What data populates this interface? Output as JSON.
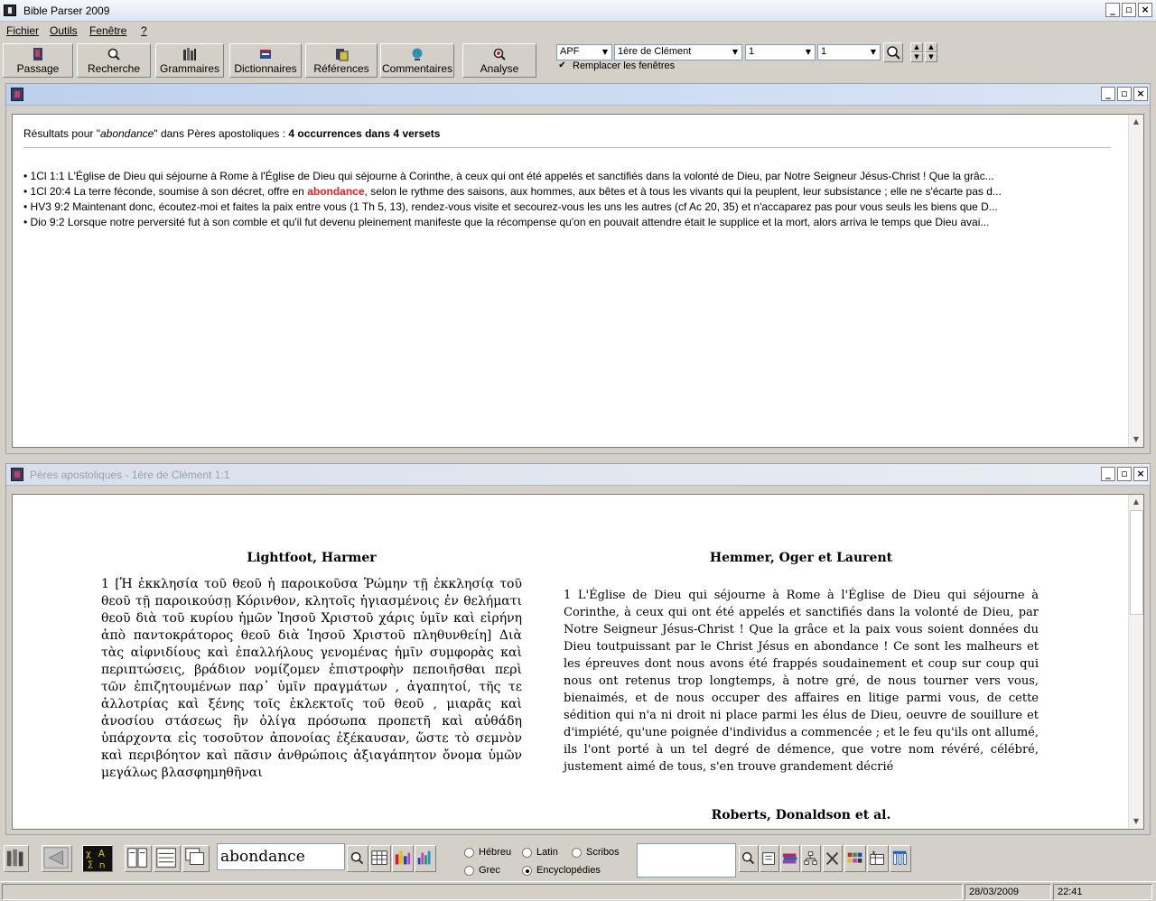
{
  "app": {
    "title": "Bible Parser 2009"
  },
  "window_buttons": {
    "minimize": "_",
    "restore": "▫",
    "close": "×"
  },
  "menu": [
    "Fichier",
    "Outils",
    "Fenêtre",
    "?"
  ],
  "toolbar": {
    "buttons": [
      "Passage",
      "Recherche",
      "Grammaires",
      "Dictionnaires",
      "Références",
      "Commentaires",
      "Analyse"
    ],
    "combo_version": "APF",
    "combo_book": "1ère de Clément",
    "combo_chapter": "1",
    "combo_verse": "1",
    "replace_windows_label": "Remplacer les fenêtres",
    "replace_windows_checked": true
  },
  "results_window": {
    "header_prefix": "Résultats pour \"",
    "query": "abondance",
    "header_mid": "\" dans Pères apostoliques : ",
    "header_count": "4 occurrences dans 4 versets",
    "lines": [
      {
        "bullet": "•",
        "before": "1Cl 1:1 L'Église de Dieu qui séjourne à Rome à l'Église de Dieu qui séjourne à Corinthe, à ceux qui ont été appelés et sanctifiés dans la volonté de Dieu, par Notre Seigneur Jésus-Christ ! Que la grâc...",
        "match": "",
        "after": ""
      },
      {
        "bullet": "•",
        "before": "1Cl 20:4 La terre féconde, soumise à son décret, offre en ",
        "match": "abondance",
        "after": ", selon le rythme des saisons, aux hommes, aux bêtes et à tous les vivants qui la peuplent, leur subsistance ; elle ne s'écarte pas d..."
      },
      {
        "bullet": "•",
        "before": "HV3 9:2 Maintenant donc, écoutez-moi et faites la paix entre vous (1 Th 5, 13), rendez-vous visite et secourez-vous les uns les autres (cf Ac 20, 35) et n'accaparez pas pour vous seuls les biens que D...",
        "match": "",
        "after": ""
      },
      {
        "bullet": "•",
        "before": "Dio 9:2 Lorsque notre perversité fut à son comble et qu'il fut devenu pleinement manifeste que la récompense qu'on en pouvait attendre était le supplice et la mort, alors arriva le temps que Dieu avai...",
        "match": "",
        "after": ""
      }
    ]
  },
  "text_window": {
    "title": "Pères apostoliques - 1ère de Clément 1:1",
    "col1_heading": "Lightfoot, Harmer",
    "col1_text": "1 [Ἡ ἐκκλησία τοῦ θεοῦ ἡ παροικοῦσα Ῥώμην τῇ ἐκκλησίᾳ τοῦ θεοῦ τῇ παροικούσῃ Κόρινθον, κλητοῖς ἡγιασμένοις ἐν θελήματι θεοῦ διὰ τοῦ κυρίου ἡμῶν Ἰησοῦ Χριστοῦ χάρις ὑμῖν καὶ εἰρήνη ἀπὸ παντοκράτορος θεοῦ διὰ Ἰησοῦ Χριστοῦ πληθυνθείη] Διὰ τὰς αἰφνιδίους καὶ ἐπαλλήλους γενομένας ἡμῖν συμφορὰς καὶ περιπτώσεις, βράδιον νομίζομεν ἐπιστροφὴν πεποιῆσθαι περὶ τῶν ἐπιζητουμένων παρ᾽ ὑμῖν πραγμάτων , ἀγαπητοί, τῆς τε ἀλλοτρίας καὶ ξένης τοῖς ἐκλεκτοῖς τοῦ θεοῦ , μιαρᾶς καὶ ἀνοσίου στάσεως ἣν ὀλίγα πρόσωπα προπετῆ καὶ αὐθάδη ὑπάρχοντα εἰς τοσοῦτον ἀπονοίας ἐξέκαυσαν, ὥστε τὸ σεμνὸν καὶ περιβόητον καὶ πᾶσιν ἀνθρώποις ἀξιαγάπητον ὄνομα ὑμῶν μεγάλως βλασφημηθῆναι",
    "col2_heading": "Hemmer, Oger et Laurent",
    "col2_text": "1 L'Église de Dieu qui séjourne à Rome à l'Église de Dieu qui séjourne à Corinthe, à ceux qui ont été appelés et sanctifiés dans la volonté de Dieu, par Notre Seigneur Jésus-Christ ! Que la grâce et la paix vous soient données du Dieu toutpuissant par le Christ Jésus en abondance ! Ce sont les malheurs et les épreuves dont nous avons été frappés soudainement et coup sur coup qui nous ont retenus trop longtemps, à notre gré, de nous tourner vers vous, bienaimés, et de nous occuper des affaires en litige parmi vous, de cette sédition qui n'a ni droit ni place parmi les élus de Dieu, oeuvre de souillure et d'impiété, qu'une poignée d'individus a commencée ; et le feu qu'ils ont allumé, ils l'ont porté à un tel degré de démence, que votre nom révéré, célébré, justement aimé de tous, s'en trouve grandement décrié",
    "col2_heading_b": "Roberts, Donaldson et al."
  },
  "bottom": {
    "search_value": "abondance",
    "radio_hebrew": "Hébreu",
    "radio_latin": "Latin",
    "radio_scribes": "Scribos",
    "radio_greek": "Grec",
    "radio_encyclo": "Encyclopédies",
    "selected_radio": "Encyclopédies"
  },
  "status": {
    "date": "28/03/2009",
    "time": "22:41"
  }
}
